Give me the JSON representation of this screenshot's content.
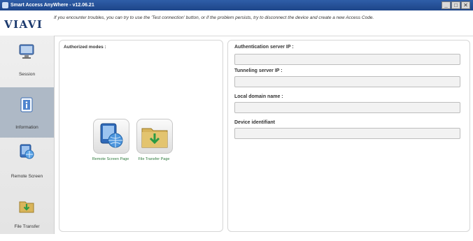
{
  "window": {
    "title": "Smart Access AnyWhere - v12.06.21"
  },
  "window_controls": {
    "minimize": "_",
    "maximize": "□",
    "close": "✕"
  },
  "header": {
    "logo": "VIAVI",
    "notice": "If you encounter troubles, you can try to use the 'Test connection' button, or if the problem persists, try to disconnect the device and create a new Access Code."
  },
  "sidebar": {
    "items": [
      {
        "label": "Session",
        "icon": "session-icon",
        "active": false
      },
      {
        "label": "Information",
        "icon": "information-icon",
        "active": true
      },
      {
        "label": "Remote Screen",
        "icon": "remote-screen-icon",
        "active": false
      },
      {
        "label": "File Transfer",
        "icon": "file-transfer-icon",
        "active": false
      }
    ]
  },
  "authorized_modes": {
    "title": "Authorized modes :",
    "tiles": [
      {
        "label": "Remote Screen Page",
        "icon": "remote-screen-icon"
      },
      {
        "label": "File Transfer Page",
        "icon": "folder-download-icon"
      }
    ]
  },
  "info": {
    "fields": [
      {
        "label": "Authentication server IP :",
        "value": ""
      },
      {
        "label": "Tunneling server IP :",
        "value": ""
      },
      {
        "label": "Local domain name :",
        "value": ""
      },
      {
        "label": "Device identifiant",
        "value": ""
      }
    ]
  },
  "colors": {
    "accent": "#1d4589",
    "active_nav": "#aeb9c6",
    "tile_label": "#2f7a3d"
  }
}
